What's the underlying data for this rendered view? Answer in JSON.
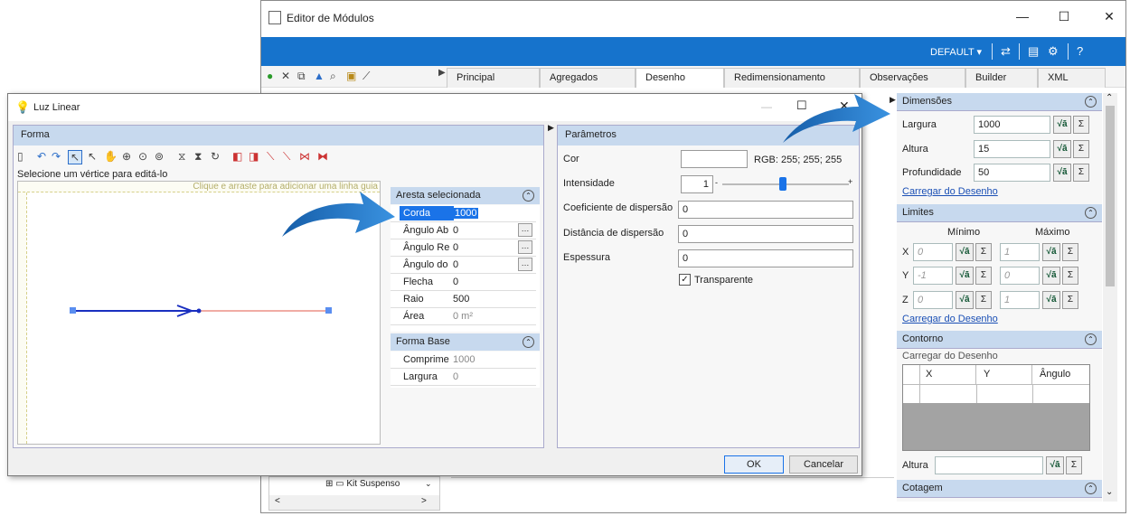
{
  "main_window": {
    "title": "Editor de Módulos",
    "minimize": "—",
    "maximize": "☐",
    "close": "✕",
    "profile": "DEFAULT",
    "tabs": [
      "Principal",
      "Agregados",
      "Desenho",
      "Redimensionamento",
      "Observações",
      "Builder",
      "XML"
    ],
    "active_tab": "Desenho",
    "tree_item": "Kit Suspenso",
    "dimensions": {
      "header": "Dimensões",
      "largura_label": "Largura",
      "largura_value": "1000",
      "altura_label": "Altura",
      "altura_value": "15",
      "profundidade_label": "Profundidade",
      "profundidade_value": "50",
      "link": "Carregar do Desenho"
    },
    "limits": {
      "header": "Limites",
      "min_label": "Mínimo",
      "max_label": "Máximo",
      "rows": [
        {
          "axis": "X",
          "min": "0",
          "max": "1"
        },
        {
          "axis": "Y",
          "min": "-1",
          "max": "0"
        },
        {
          "axis": "Z",
          "min": "0",
          "max": "1"
        }
      ],
      "link": "Carregar do Desenho"
    },
    "contour": {
      "header": "Contorno",
      "subtitle": "Carregar do Desenho",
      "columns": [
        "X",
        "Y",
        "Ângulo"
      ],
      "altura_label": "Altura"
    },
    "cotagem": {
      "header": "Cotagem"
    }
  },
  "dialog": {
    "title": "Luz Linear",
    "forma_header": "Forma",
    "hint": "Selecione um vértice para editá-lo",
    "guide": "Clique e arraste para adicionar uma linha guia",
    "aresta_header": "Aresta selecionada",
    "aresta_rows": [
      {
        "k": "Corda",
        "v": "1000"
      },
      {
        "k": "Ângulo Ab",
        "v": "0"
      },
      {
        "k": "Ângulo Re",
        "v": "0"
      },
      {
        "k": "Ângulo do",
        "v": "0"
      },
      {
        "k": "Flecha",
        "v": "0"
      },
      {
        "k": "Raio",
        "v": "500"
      },
      {
        "k": "Área",
        "v": "0 m²"
      }
    ],
    "forma_base_header": "Forma Base",
    "forma_base_rows": [
      {
        "k": "Comprime",
        "v": "1000"
      },
      {
        "k": "Largura",
        "v": "0"
      }
    ],
    "params_header": "Parâmetros",
    "cor_label": "Cor",
    "cor_rgb": "RGB: 255; 255; 255",
    "intensidade_label": "Intensidade",
    "intensidade_value": "1",
    "coef_label": "Coeficiente de dispersão",
    "coef_value": "0",
    "dist_label": "Distância de dispersão",
    "dist_value": "0",
    "esp_label": "Espessura",
    "esp_value": "0",
    "transparente_label": "Transparente",
    "ok": "OK",
    "cancel": "Cancelar"
  },
  "colors": {
    "accent": "#1673cc",
    "header": "#c7d9ee",
    "arrow": "#1f78c8",
    "shape_line": "#e05a4a"
  }
}
